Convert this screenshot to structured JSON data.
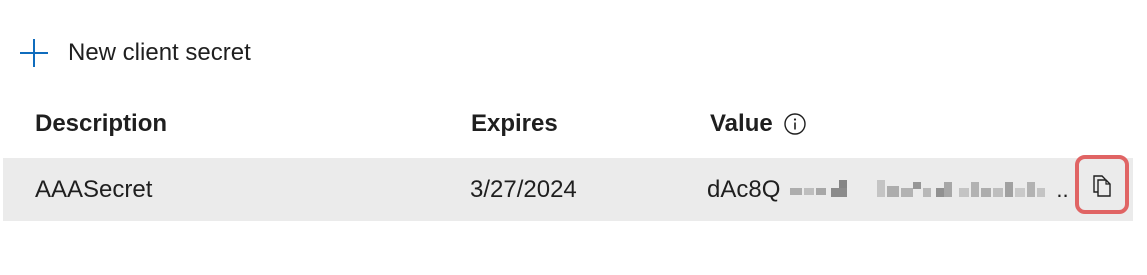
{
  "actions": {
    "new_secret_label": "New client secret",
    "new_secret_icon": "plus-icon"
  },
  "table": {
    "columns": [
      "Description",
      "Expires",
      "Value"
    ],
    "value_info_icon": "info-icon",
    "rows": [
      {
        "description": "AAASecret",
        "expires": "3/27/2024",
        "value_prefix": "dAc8Q",
        "value_ellipsis": "..",
        "copy_icon": "copy-icon"
      }
    ]
  },
  "colors": {
    "accent": "#0f6cbd",
    "row_background": "#ebebeb",
    "highlight": "#e06464"
  }
}
